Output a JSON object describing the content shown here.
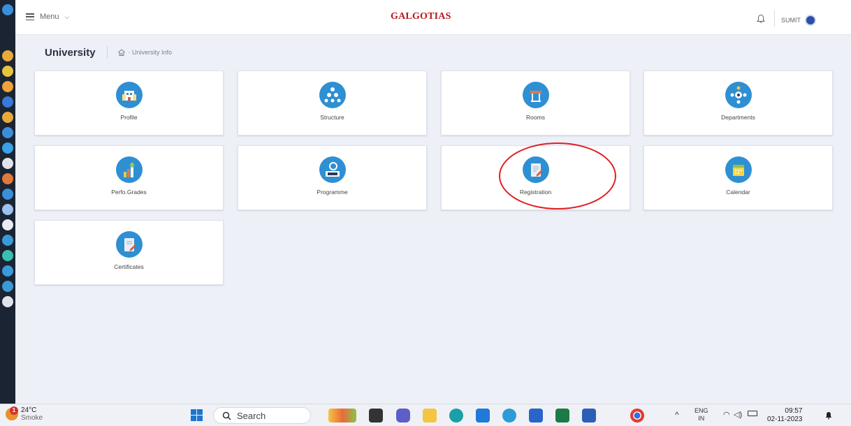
{
  "header": {
    "menu_label": "Menu",
    "logo_text": "GALGOTIAS",
    "user_name": "SUMIT"
  },
  "breadcrumb": {
    "title": "University",
    "path": "· University Info"
  },
  "cards": [
    {
      "label": "Profile",
      "icon": "building-icon"
    },
    {
      "label": "Structure",
      "icon": "hierarchy-icon"
    },
    {
      "label": "Rooms",
      "icon": "classroom-icon"
    },
    {
      "label": "Departments",
      "icon": "department-icon"
    },
    {
      "label": "Perfo.Grades",
      "icon": "bar-chart-icon"
    },
    {
      "label": "Programme",
      "icon": "programme-icon"
    },
    {
      "label": "Registration",
      "icon": "notepad-pen-icon"
    },
    {
      "label": "Calendar",
      "icon": "calendar-icon"
    },
    {
      "label": "Certificates",
      "icon": "certificate-icon"
    }
  ],
  "taskbar": {
    "temperature": "24°C",
    "condition": "Smoke",
    "weather_badge": "1",
    "search_label": "Search",
    "language": "ENG",
    "region": "IN",
    "time": "09:57",
    "date": "02-11-2023"
  },
  "colors": {
    "icon_blue": "#2f8fd3",
    "annotation_red": "#e01e23",
    "page_bg": "#eef0f8"
  }
}
